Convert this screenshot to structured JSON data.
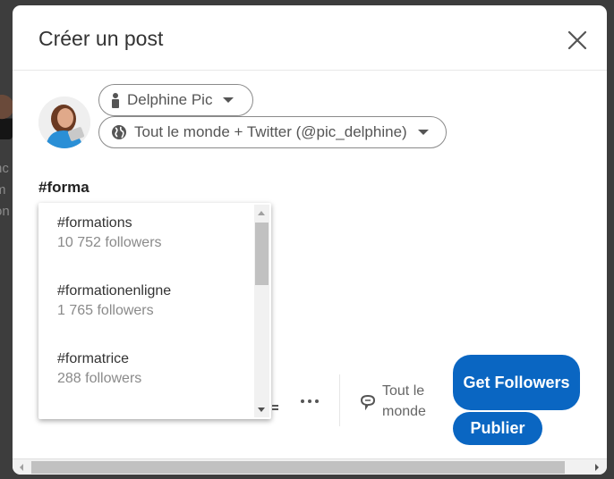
{
  "background": {
    "text_fragments": [
      "nc",
      "m",
      "on"
    ]
  },
  "modal": {
    "title": "Créer un post",
    "close_icon": "close-icon",
    "author": {
      "name": "Delphine Pic",
      "icon": "person-icon"
    },
    "visibility": {
      "label": "Tout le monde + Twitter (@pic_delphine)",
      "icon": "globe-icon"
    },
    "editor": {
      "text": "#forma"
    },
    "hashtag_suggestions": [
      {
        "tag": "#formations",
        "followers": "10 752 followers"
      },
      {
        "tag": "#formationenligne",
        "followers": "1 765 followers"
      },
      {
        "tag": "#formatrice",
        "followers": "288 followers"
      }
    ],
    "toolbar": {
      "more_icon": "more-icon",
      "comment_setting_label": "Tout le monde",
      "comment_icon": "comment-icon"
    },
    "buttons": {
      "get_followers": "Get Followers",
      "publish": "Publier"
    },
    "colors": {
      "primary": "#0a66c2"
    }
  }
}
